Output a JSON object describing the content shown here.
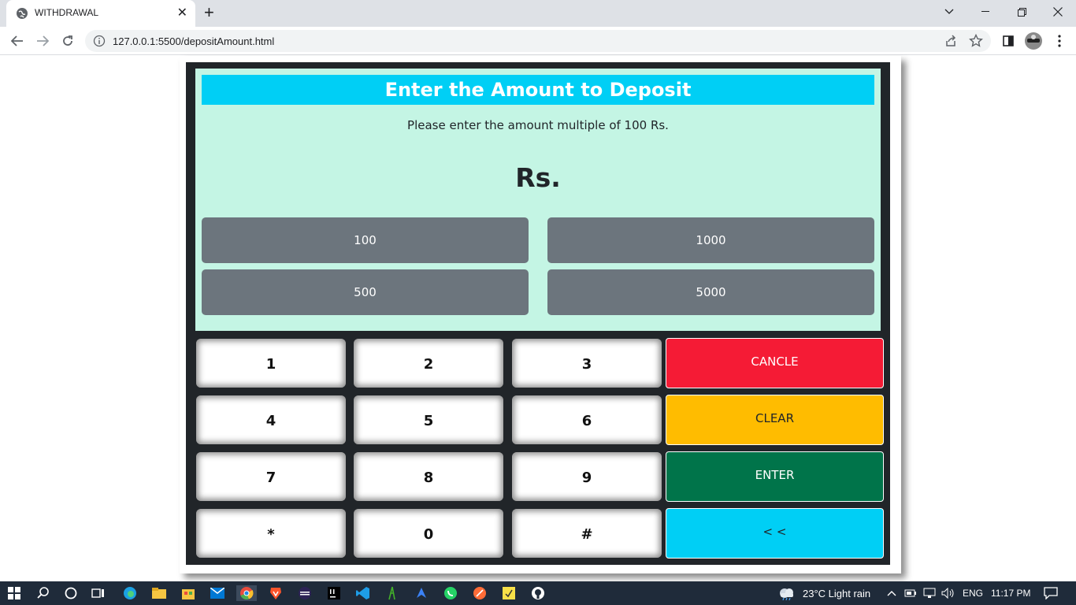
{
  "browser": {
    "tab_title": "WITHDRAWAL",
    "new_tab_label": "+",
    "url": "127.0.0.1:5500/depositAmount.html"
  },
  "screen": {
    "title": "Enter the Amount to Deposit",
    "hint": "Please enter the amount multiple of 100 Rs.",
    "currency_label": "Rs."
  },
  "quick_amounts": [
    "100",
    "1000",
    "500",
    "5000"
  ],
  "keypad": [
    "1",
    "2",
    "3",
    "4",
    "5",
    "6",
    "7",
    "8",
    "9",
    "*",
    "0",
    "#"
  ],
  "actions": {
    "cancel": "CANCLE",
    "clear": "CLEAR",
    "enter": "ENTER",
    "back": "< <"
  },
  "colors": {
    "title_bar": "#00cff5",
    "screen_bg": "#c4f5e4",
    "cancel": "#f51b35",
    "clear": "#ffbc00",
    "enter": "#00744a",
    "back": "#00cff5",
    "quick_button": "#6c757d"
  },
  "taskbar": {
    "weather": "23°C  Light rain",
    "language": "ENG",
    "time": "11:17 PM"
  }
}
